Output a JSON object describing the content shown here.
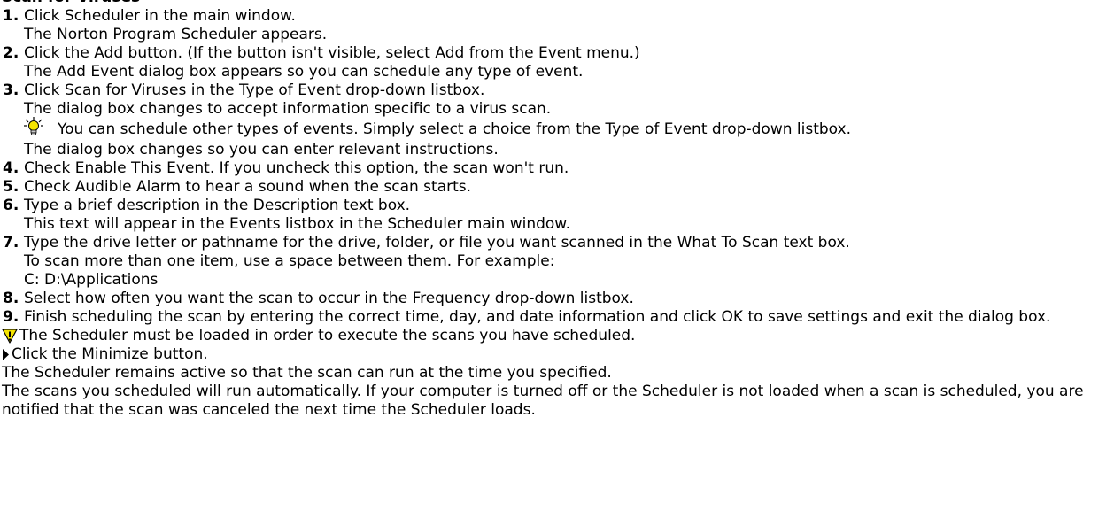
{
  "heading": "Scan for Viruses",
  "steps": [
    {
      "number": "1.",
      "lines": [
        "Click Scheduler in the main window.",
        "The Norton Program Scheduler appears."
      ]
    },
    {
      "number": "2.",
      "lines": [
        "Click the Add button. (If the button isn't visible, select Add from the Event menu.)",
        "The Add Event dialog box appears so you can schedule any type of event."
      ]
    },
    {
      "number": "3.",
      "lines": [
        "Click Scan for Viruses in the Type of Event drop-down listbox.",
        "The dialog box changes to accept information specific to a virus scan."
      ],
      "tip": {
        "icon": "lightbulb-icon",
        "text": "You can schedule other types of events. Simply select a choice from the Type of Event drop-down listbox.",
        "after": "The dialog box changes so you can enter relevant instructions."
      }
    },
    {
      "number": "4.",
      "lines": [
        "Check Enable This Event. If you uncheck this option, the scan won't run."
      ]
    },
    {
      "number": "5.",
      "lines": [
        "Check Audible Alarm to hear a sound when the scan starts."
      ]
    },
    {
      "number": "6.",
      "lines": [
        "Type a brief description in the Description text box.",
        "This text will appear in the Events listbox in the Scheduler main window."
      ]
    },
    {
      "number": "7.",
      "lines": [
        "Type the drive letter or pathname for the drive, folder, or file you want scanned in the What To Scan text box.",
        "To scan more than one item, use a space between them. For example:",
        "C: D:\\Applications"
      ]
    },
    {
      "number": "8.",
      "lines": [
        "Select how often you want the scan to occur in the Frequency drop-down listbox."
      ]
    },
    {
      "number": "9.",
      "lines": [
        "Finish scheduling the scan by entering the correct time, day, and date information and click OK to save settings and exit the dialog box."
      ]
    }
  ],
  "warning": {
    "icon": "warning-icon",
    "text": "The Scheduler must be loaded in order to execute the scans you have scheduled."
  },
  "action": {
    "icon": "arrow-right-icon",
    "text": "Click the Minimize button."
  },
  "result": "The Scheduler remains active so that the scan can run at the time you specified.",
  "closing": "The scans you scheduled will run automatically. If your computer is turned off or the Scheduler is not loaded when a scan is scheduled, you are notified that the scan was canceled the next time the Scheduler loads.",
  "colors": {
    "text": "#000000",
    "background": "#ffffff",
    "bulb": "#f5e400",
    "warning": "#f5e400"
  }
}
